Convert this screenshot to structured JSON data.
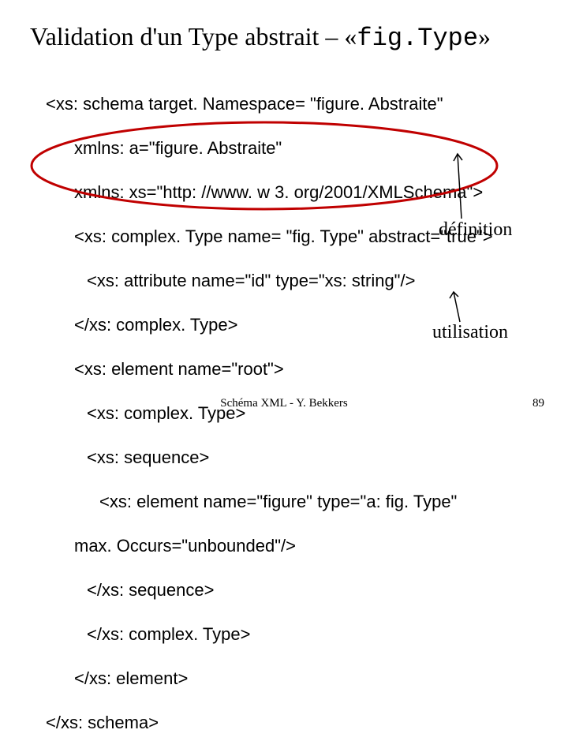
{
  "title": {
    "prefix": "Validation d'un Type abstrait – «",
    "mono": "fig.Type",
    "suffix": "»"
  },
  "code": {
    "l01": "<xs: schema target. Namespace= \"figure. Abstraite\"",
    "l02": "xmlns: a=\"figure. Abstraite\"",
    "l03": "xmlns: xs=\"http: //www. w 3. org/2001/XMLSchema\">",
    "l04": "<xs: complex. Type name= \"fig. Type\" abstract=\"true\">",
    "l05": "<xs: attribute name=\"id\" type=\"xs: string\"/>",
    "l06": "</xs: complex. Type>",
    "l07": "<xs: element name=\"root\">",
    "l08": "<xs: complex. Type>",
    "l09": "<xs: sequence>",
    "l10": "<xs: element name=\"figure\" type=\"a: fig. Type\"",
    "l11": "max. Occurs=\"unbounded\"/>",
    "l12": "</xs: sequence>",
    "l13": "</xs: complex. Type>",
    "l14": "</xs: element>",
    "l15": "</xs: schema>"
  },
  "labels": {
    "definition": "définition",
    "utilisation": "utilisation"
  },
  "footer": {
    "center": "Schéma XML - Y. Bekkers",
    "page": "89"
  }
}
